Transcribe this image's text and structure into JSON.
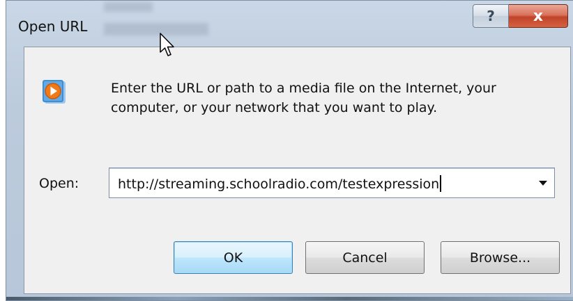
{
  "window": {
    "title": "Open URL"
  },
  "titlebar": {
    "help_label": "?",
    "close_label": "x"
  },
  "dialog": {
    "icon": "windows-media-player-icon",
    "message": "Enter the URL or path to a media file on the Internet, your computer, or your network that you want to play.",
    "open_label": "Open:",
    "url_value": "http://streaming.schoolradio.com/testexpression"
  },
  "buttons": {
    "ok_label": "OK",
    "cancel_label": "Cancel",
    "browse_label": "Browse..."
  },
  "colors": {
    "accent": "#3c7fb1",
    "close_button": "#c1432a",
    "icon_orange": "#f07a1a",
    "icon_blue": "#3b8fd6"
  }
}
